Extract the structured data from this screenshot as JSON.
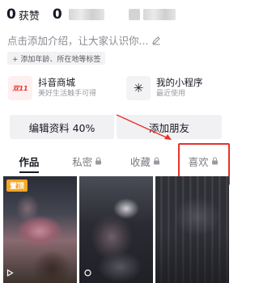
{
  "profile": {
    "likes_count": "0",
    "likes_label": "获赞",
    "second_count": "0"
  },
  "bio_placeholder": "点击添加介绍，让大家认识你...",
  "tag_chip": "+ 添加年龄、所在地等标签",
  "services": [
    {
      "title": "抖音商城",
      "subtitle": "美好生活触手可得",
      "icon": "shopping-mall-icon",
      "icon_text": "双11"
    },
    {
      "title": "我的小程序",
      "subtitle": "最近使用",
      "icon": "mini-program-icon",
      "icon_text": "✳"
    }
  ],
  "buttons": {
    "edit_profile": "编辑资料 40%",
    "add_friend": "添加朋友"
  },
  "tabs": [
    {
      "label": "作品",
      "active": true,
      "locked": false
    },
    {
      "label": "私密",
      "active": false,
      "locked": true
    },
    {
      "label": "收藏",
      "active": false,
      "locked": true
    },
    {
      "label": "喜欢",
      "active": false,
      "locked": true
    }
  ],
  "videos": {
    "pinned_label": "置顶"
  },
  "colors": {
    "highlight_red": "#e8322c",
    "pinned_orange": "#f5a623",
    "mall_red": "#e8322c"
  }
}
